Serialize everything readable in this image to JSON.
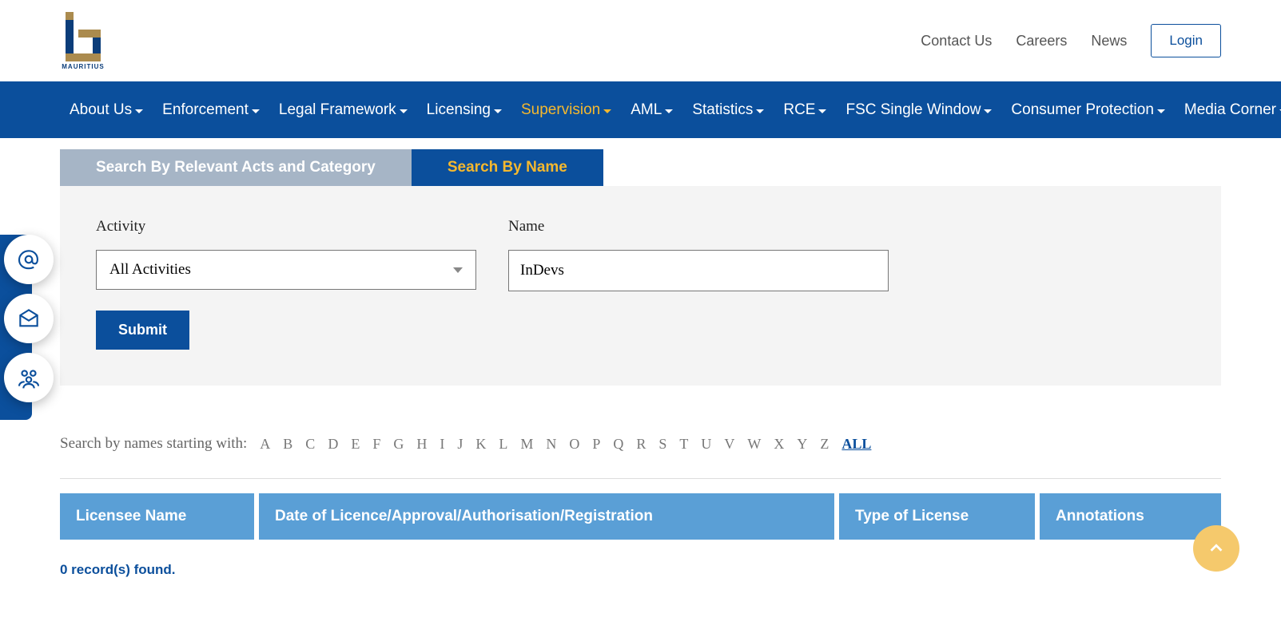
{
  "header": {
    "logo_text": "MAURITIUS",
    "links": [
      "Contact Us",
      "Careers",
      "News"
    ],
    "login": "Login"
  },
  "nav": {
    "items": [
      {
        "label": "About Us",
        "active": false
      },
      {
        "label": "Enforcement",
        "active": false
      },
      {
        "label": "Legal Framework",
        "active": false
      },
      {
        "label": "Licensing",
        "active": false
      },
      {
        "label": "Supervision",
        "active": true
      },
      {
        "label": "AML",
        "active": false
      },
      {
        "label": "Statistics",
        "active": false
      },
      {
        "label": "RCE",
        "active": false
      },
      {
        "label": "FSC Single Window",
        "active": false
      },
      {
        "label": "Consumer Protection",
        "active": false
      },
      {
        "label": "Media Corner",
        "active": false
      }
    ]
  },
  "tabs": {
    "inactive": "Search By Relevant Acts and Category",
    "active": "Search By Name"
  },
  "form": {
    "activity_label": "Activity",
    "activity_value": "All Activities",
    "name_label": "Name",
    "name_value": "InDevs",
    "submit": "Submit"
  },
  "alpha": {
    "label": "Search by names starting with:",
    "letters": [
      "A",
      "B",
      "C",
      "D",
      "E",
      "F",
      "G",
      "H",
      "I",
      "J",
      "K",
      "L",
      "M",
      "N",
      "O",
      "P",
      "Q",
      "R",
      "S",
      "T",
      "U",
      "V",
      "W",
      "X",
      "Y",
      "Z"
    ],
    "all": "ALL"
  },
  "table": {
    "headers": [
      "Licensee Name",
      "Date of Licence/Approval/Authorisation/Registration",
      "Type of License",
      "Annotations"
    ]
  },
  "results": {
    "count_text": "0 record(s) found."
  },
  "side": {
    "email": "email-icon",
    "inbox": "inbox-icon",
    "group": "group-icon"
  }
}
